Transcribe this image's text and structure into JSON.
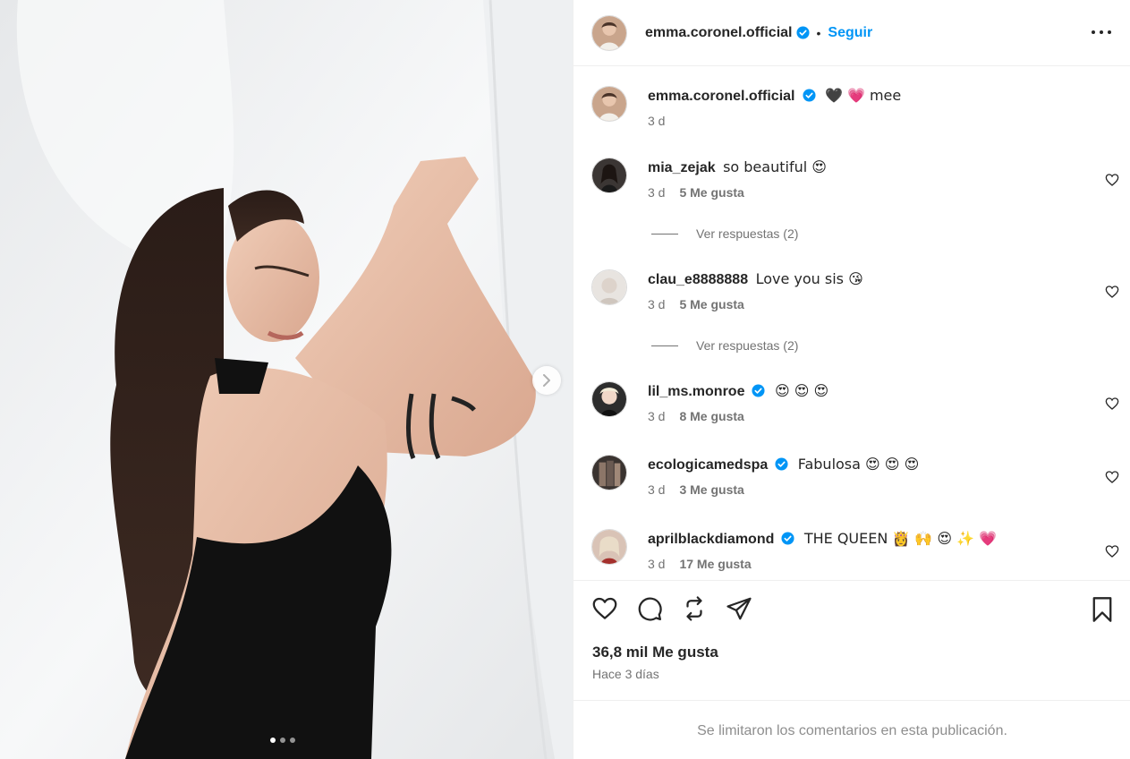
{
  "post": {
    "author": "emma.coronel.official",
    "follow_label": "Seguir",
    "separator": "•"
  },
  "caption": {
    "username": "emma.coronel.official",
    "text": "🖤 💗 mee",
    "time": "3 d"
  },
  "comments": [
    {
      "username": "mia_zejak",
      "verified": false,
      "text": "so beautiful 😍",
      "time": "3 d",
      "likes": "5 Me gusta",
      "replies": "Ver respuestas (2)"
    },
    {
      "username": "clau_e8888888",
      "verified": false,
      "text": "Love you sis 😘",
      "time": "3 d",
      "likes": "5 Me gusta",
      "replies": "Ver respuestas (2)"
    },
    {
      "username": "lil_ms.monroe",
      "verified": true,
      "text": "😍 😍 😍",
      "time": "3 d",
      "likes": "8 Me gusta"
    },
    {
      "username": "ecologicamedspa",
      "verified": true,
      "text": "Fabulosa 😍 😍 😍",
      "time": "3 d",
      "likes": "3 Me gusta"
    },
    {
      "username": "aprilblackdiamond",
      "verified": true,
      "text": "THE QUEEN 👸 🙌 😍 ✨ 💗",
      "time": "3 d",
      "likes": "17 Me gusta"
    }
  ],
  "footer": {
    "likes_total": "36,8 mil Me gusta",
    "posted": "Hace 3 días",
    "comments_limited": "Se limitaron los comentarios en esta publicación."
  },
  "carousel": {
    "current": 1,
    "total": 3
  },
  "icons": [
    "verified-badge-icon",
    "more-options-icon",
    "heart-icon",
    "comment-icon",
    "repost-icon",
    "share-icon",
    "bookmark-icon",
    "chevron-right-icon"
  ],
  "colors": {
    "accent": "#0095f6",
    "text": "#262626",
    "muted": "#737373"
  }
}
